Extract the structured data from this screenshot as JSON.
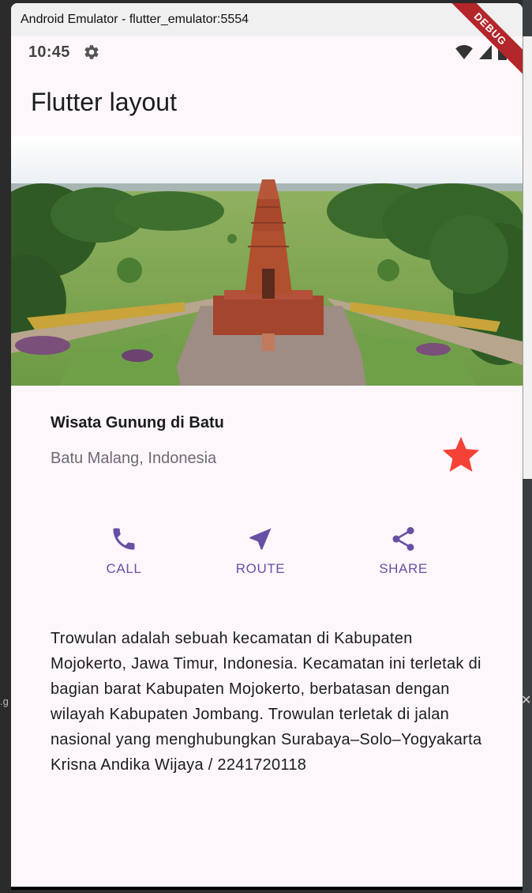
{
  "window": {
    "title": "Android Emulator - flutter_emulator:5554"
  },
  "status_bar": {
    "time": "10:45",
    "debug_banner": "DEBUG"
  },
  "app_bar": {
    "title": "Flutter layout"
  },
  "title_section": {
    "name": "Wisata Gunung di Batu",
    "location": "Batu Malang, Indonesia",
    "favorite": true
  },
  "actions": [
    {
      "label": "CALL",
      "icon": "phone-icon"
    },
    {
      "label": "ROUTE",
      "icon": "near-me-icon"
    },
    {
      "label": "SHARE",
      "icon": "share-icon"
    }
  ],
  "description": "Trowulan adalah sebuah kecamatan di Kabupaten Mojokerto, Jawa Timur, Indonesia. Kecamatan ini terletak di bagian barat Kabupaten Mojokerto, berbatasan dengan wilayah Kabupaten Jombang. Trowulan terletak di jalan nasional yang menghubungkan Surabaya–Solo–Yogyakarta Krisna Andika Wijaya / 2241720118",
  "colors": {
    "accent": "#6750a4",
    "star": "#f44336",
    "background": "#fdf7fc"
  }
}
